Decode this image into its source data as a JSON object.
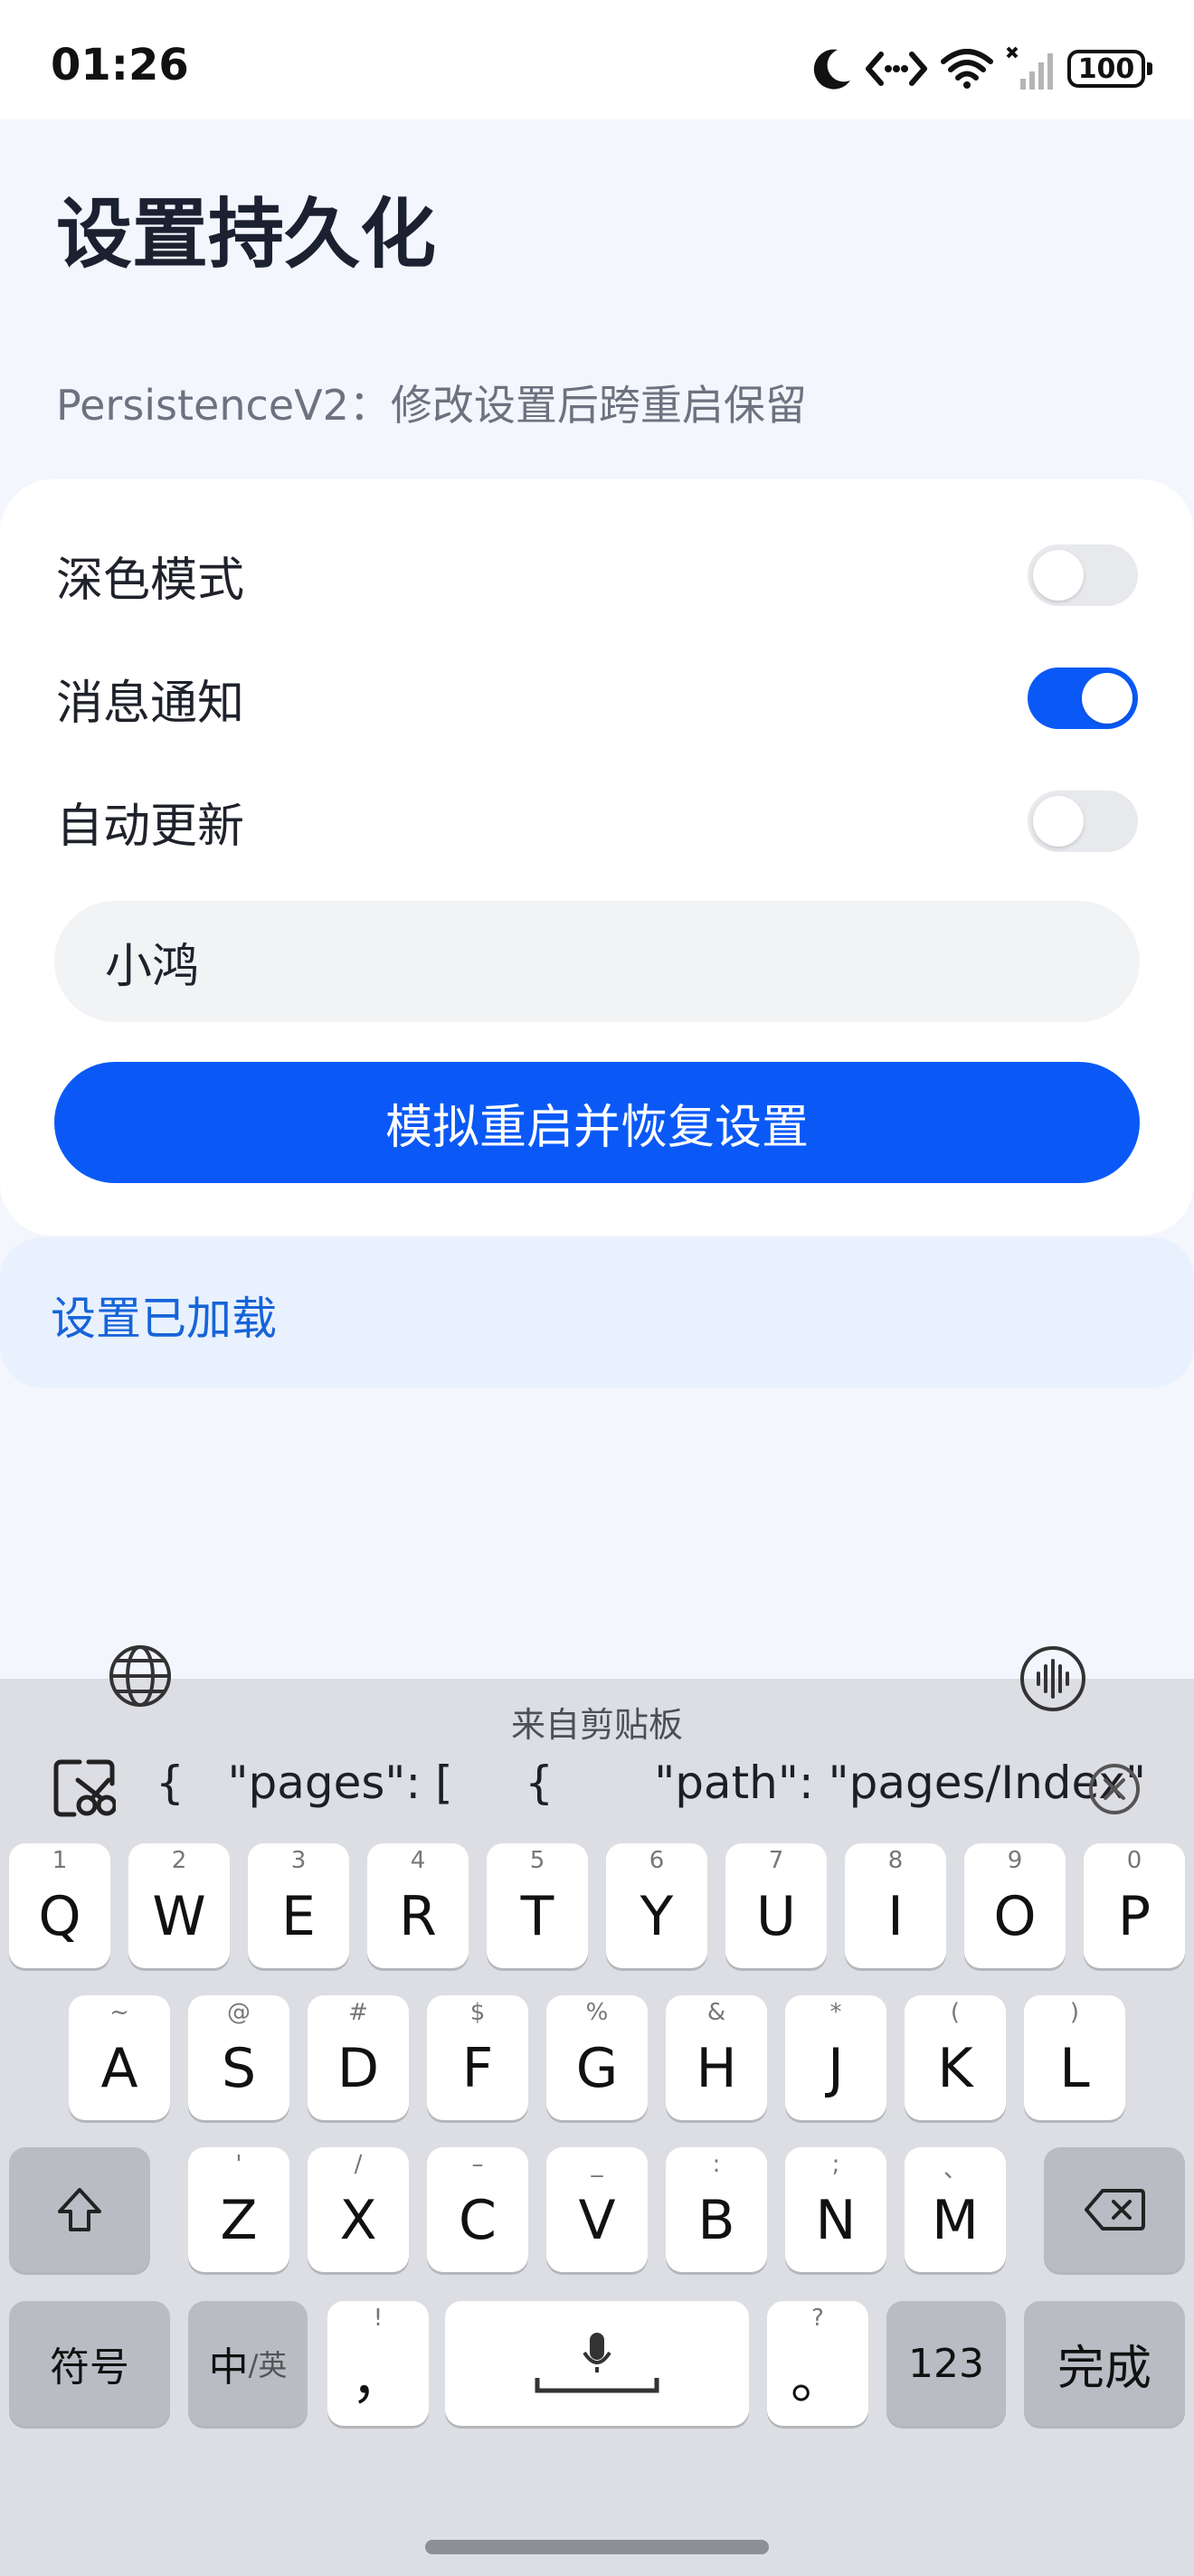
{
  "status_bar": {
    "time": "01:26",
    "battery": "100"
  },
  "header": {
    "title": "设置持久化",
    "subtitle": "PersistenceV2：修改设置后跨重启保留"
  },
  "settings": {
    "items": [
      {
        "label": "深色模式",
        "enabled": false
      },
      {
        "label": "消息通知",
        "enabled": true
      },
      {
        "label": "自动更新",
        "enabled": false
      }
    ],
    "name_value": "小鸿",
    "button_label": "模拟重启并恢复设置"
  },
  "status": {
    "text": "设置已加载"
  },
  "colors": {
    "accent": "#0a59f7",
    "status_text": "#1664d9",
    "status_bg": "#e8f1fd"
  },
  "keyboard": {
    "clipboard_title": "来自剪贴板",
    "clipboard_text": "{   \"pages\": [     {       \"path\": \"pages/Index\"",
    "row1": [
      {
        "key": "Q",
        "hint": "1"
      },
      {
        "key": "W",
        "hint": "2"
      },
      {
        "key": "E",
        "hint": "3"
      },
      {
        "key": "R",
        "hint": "4"
      },
      {
        "key": "T",
        "hint": "5"
      },
      {
        "key": "Y",
        "hint": "6"
      },
      {
        "key": "U",
        "hint": "7"
      },
      {
        "key": "I",
        "hint": "8"
      },
      {
        "key": "O",
        "hint": "9"
      },
      {
        "key": "P",
        "hint": "0"
      }
    ],
    "row2": [
      {
        "key": "A",
        "hint": "~"
      },
      {
        "key": "S",
        "hint": "@"
      },
      {
        "key": "D",
        "hint": "#"
      },
      {
        "key": "F",
        "hint": "$"
      },
      {
        "key": "G",
        "hint": "%"
      },
      {
        "key": "H",
        "hint": "&"
      },
      {
        "key": "J",
        "hint": "*"
      },
      {
        "key": "K",
        "hint": "("
      },
      {
        "key": "L",
        "hint": ")"
      }
    ],
    "row3": [
      {
        "key": "Z",
        "hint": "'"
      },
      {
        "key": "X",
        "hint": "/"
      },
      {
        "key": "C",
        "hint": "–"
      },
      {
        "key": "V",
        "hint": "_"
      },
      {
        "key": "B",
        "hint": ":"
      },
      {
        "key": "N",
        "hint": ";"
      },
      {
        "key": "M",
        "hint": "、"
      }
    ],
    "symbols_label": "符号",
    "lang_main": "中",
    "lang_sub": "/英",
    "comma": "，",
    "comma_hint": "!",
    "period": "。",
    "period_hint": "?",
    "num_label": "123",
    "done_label": "完成"
  }
}
